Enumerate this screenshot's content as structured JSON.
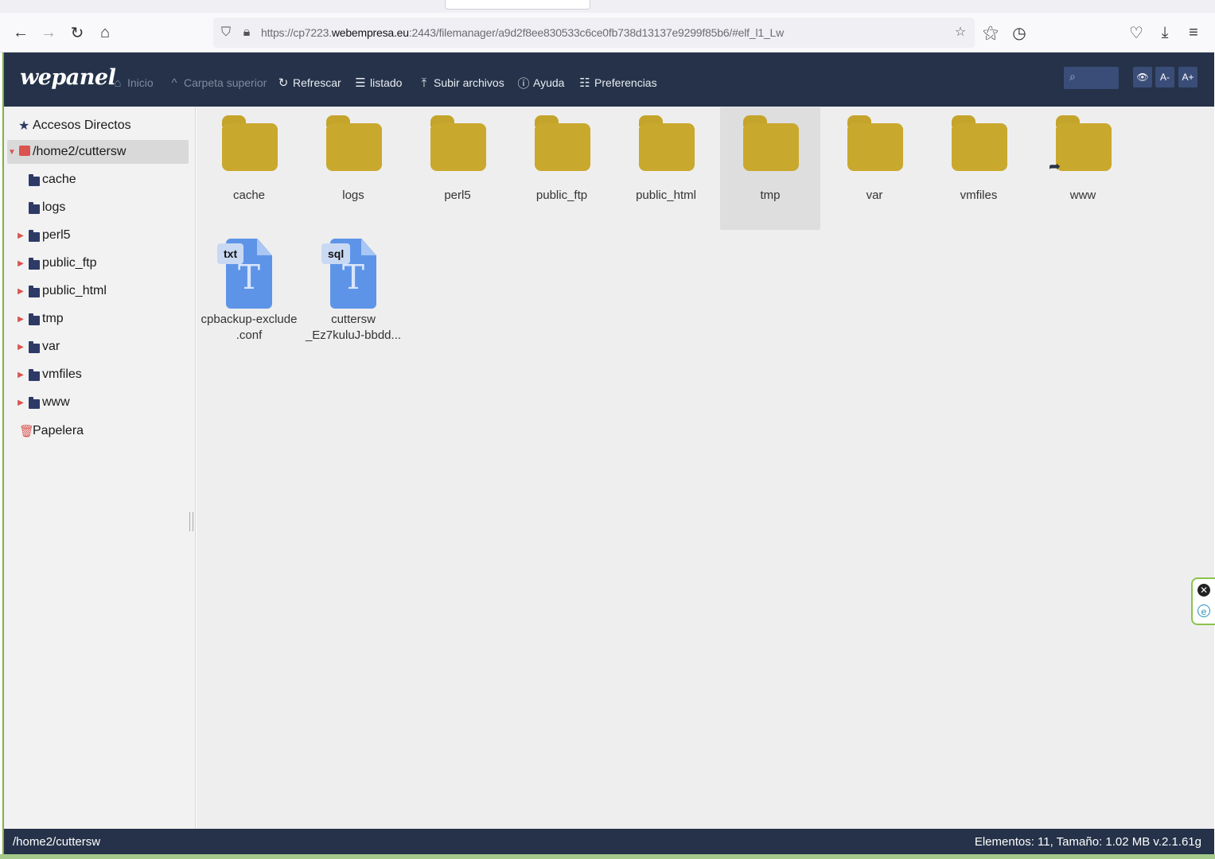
{
  "browser": {
    "url_prefix": "https://cp7223.",
    "url_host": "webempresa.eu",
    "url_rest": ":2443/filemanager/a9d2f8ee830533c6ce0fb738d13137e9299f85b6/#elf_l1_Lw",
    "icons": [
      "back-icon",
      "forward-icon",
      "reload-icon",
      "home-icon",
      "shield-icon",
      "lock-icon",
      "star-icon",
      "extensions-icon",
      "history-icon",
      "pocket-icon",
      "download-icon",
      "menu-icon"
    ]
  },
  "app": {
    "logo": "wepanel",
    "toolbar": {
      "inicio": "Inicio",
      "carpeta_superior": "Carpeta superior",
      "refrescar": "Refrescar",
      "listado": "listado",
      "subir": "Subir archivos",
      "ayuda": "Ayuda",
      "preferencias": "Preferencias"
    },
    "header_buttons": {
      "view": "👁",
      "font_smaller": "A-",
      "font_larger": "A+"
    }
  },
  "sidebar": {
    "shortcuts": "Accesos Directos",
    "root": "/home2/cuttersw",
    "items": [
      {
        "label": "cache",
        "expandable": false
      },
      {
        "label": "logs",
        "expandable": false
      },
      {
        "label": "perl5",
        "expandable": true
      },
      {
        "label": "public_ftp",
        "expandable": true
      },
      {
        "label": "public_html",
        "expandable": true
      },
      {
        "label": "tmp",
        "expandable": true
      },
      {
        "label": "var",
        "expandable": true
      },
      {
        "label": "vmfiles",
        "expandable": true
      },
      {
        "label": "www",
        "expandable": true
      }
    ],
    "trash": "Papelera"
  },
  "files": {
    "folders": [
      "cache",
      "logs",
      "perl5",
      "public_ftp",
      "public_html",
      "tmp",
      "var",
      "vmfiles",
      "www"
    ],
    "documents": [
      {
        "badge": "txt",
        "name_line1": "cpbackup-exclude",
        "name_line2": ".conf"
      },
      {
        "badge": "sql",
        "name_line1": "cuttersw",
        "name_line2": "_Ez7kuluJ-bbdd..."
      }
    ]
  },
  "status": {
    "path": "/home2/cuttersw",
    "info": "Elementos: 11, Tamaño: 1.02 MB v.2.1.61g"
  },
  "colors": {
    "header": "#253249",
    "folder": "#c9a82e",
    "doc": "#5e94e8"
  }
}
